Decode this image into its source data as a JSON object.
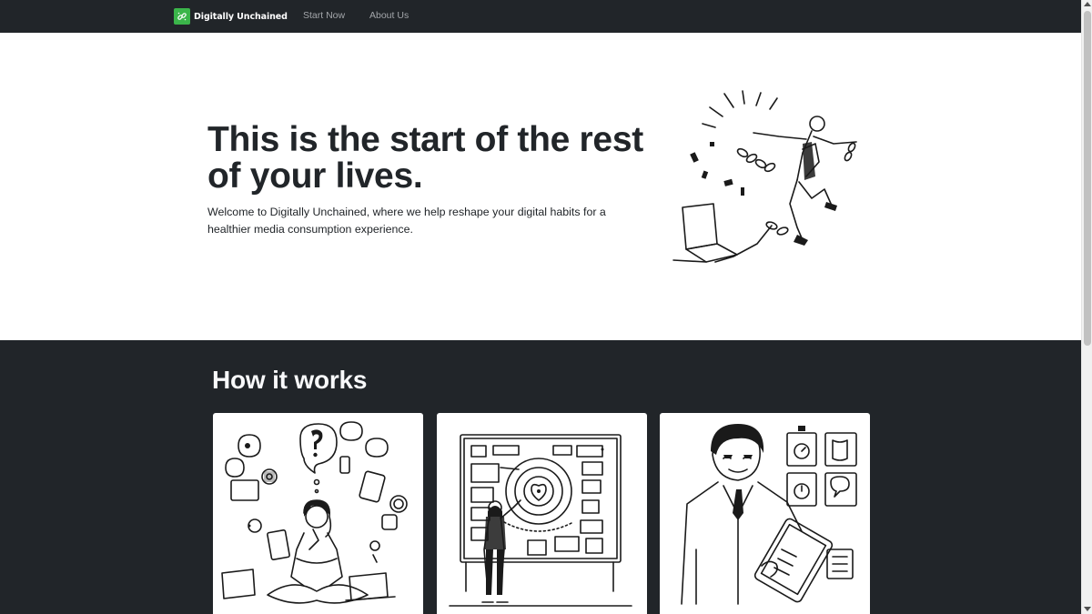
{
  "nav": {
    "brand": "Digitally Unchained",
    "brand_logo_icon": "chain-link-icon",
    "links": [
      "Start Now",
      "About Us"
    ]
  },
  "hero": {
    "title": "This is the start of the rest of your lives.",
    "text": "Welcome to Digitally Unchained, where we help reshape your digital habits for a healthier media consumption experience.",
    "illustration": "man-breaking-chains-illustration"
  },
  "how": {
    "title": "How it works",
    "cards": [
      {
        "illustration": "thinking-woman-surrounded-by-devices-illustration"
      },
      {
        "illustration": "man-planning-at-board-illustration"
      },
      {
        "illustration": "man-with-tablet-and-goals-illustration"
      }
    ]
  },
  "colors": {
    "dark": "#212529",
    "brand_green": "#3bb54a",
    "nav_link": "#a3a6aa",
    "white": "#ffffff"
  }
}
